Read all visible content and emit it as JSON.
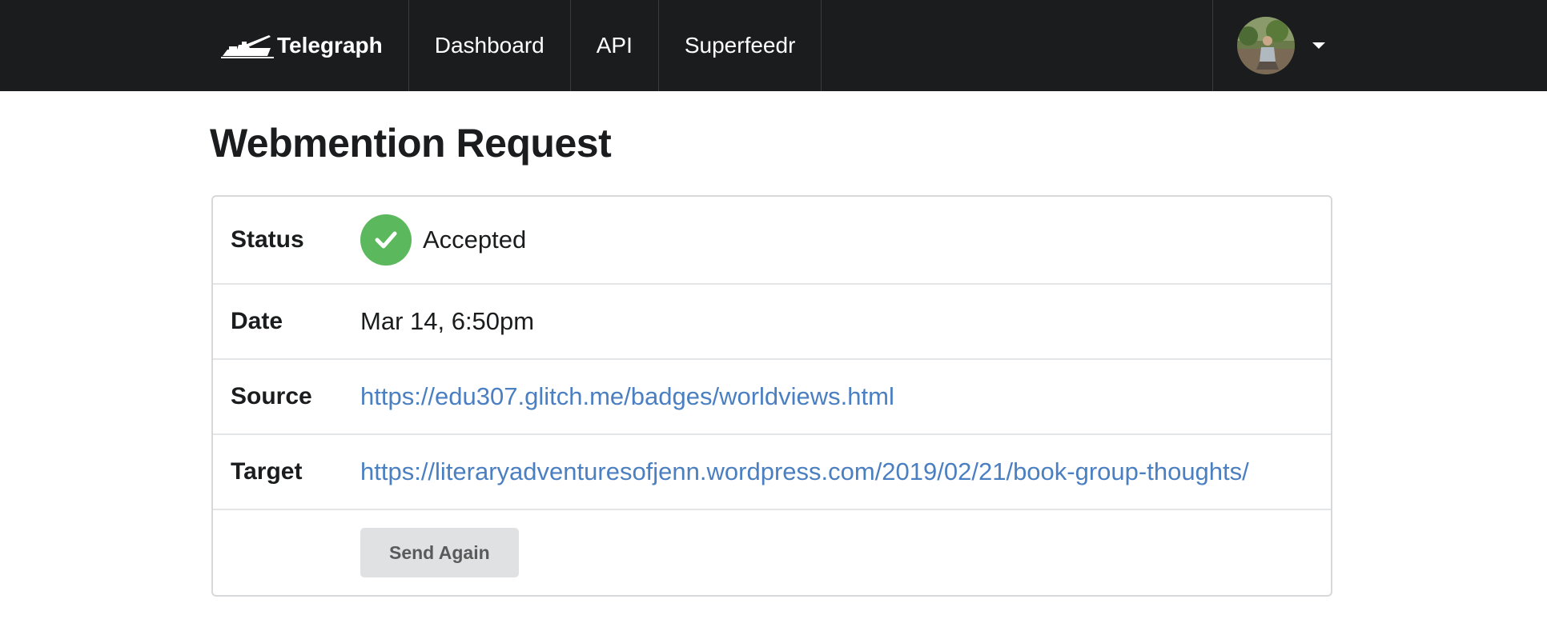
{
  "nav": {
    "brand_label": "Telegraph",
    "brand_icon": "telegraph-logo-icon",
    "items": [
      {
        "label": "Dashboard"
      },
      {
        "label": "API"
      },
      {
        "label": "Superfeedr"
      }
    ],
    "user_menu_icon": "chevron-down-icon"
  },
  "page": {
    "title": "Webmention Request"
  },
  "details": {
    "status_label": "Status",
    "status_value": "Accepted",
    "status_icon": "check-circle-icon",
    "status_color": "#5cb85c",
    "date_label": "Date",
    "date_value": "Mar 14, 6:50pm",
    "source_label": "Source",
    "source_value": "https://edu307.glitch.me/badges/worldviews.html",
    "target_label": "Target",
    "target_value": "https://literaryadventuresofjenn.wordpress.com/2019/02/21/book-group-thoughts/",
    "link_color": "#4a7fc1"
  },
  "actions": {
    "send_again_label": "Send Again"
  }
}
